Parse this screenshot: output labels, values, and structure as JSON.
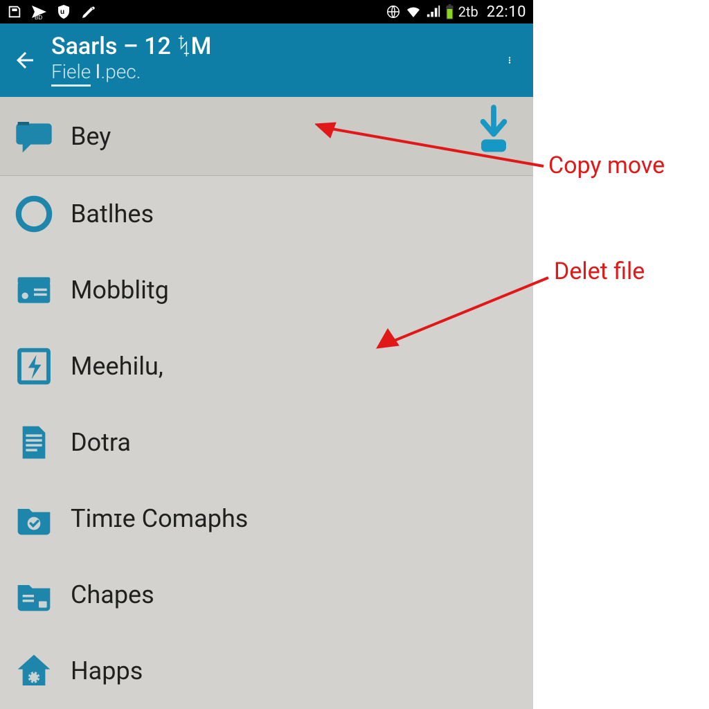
{
  "colors": {
    "accent": "#1797c4",
    "appbar": "#0f7ea6",
    "ann": "#e11818"
  },
  "status": {
    "date": "2tb",
    "time": "22:10"
  },
  "appbar": {
    "title": "Saarls – 12 ᛪM",
    "subtitle_prefix": "Fiele",
    "subtitle_rest": "ꓲ.pec."
  },
  "list": {
    "items": [
      {
        "label": "Bey"
      },
      {
        "label": "Batlhes"
      },
      {
        "label": "Mobblitg"
      },
      {
        "label": "Meehilu,"
      },
      {
        "label": "Dotra"
      },
      {
        "label": "Timɪe Comaphs"
      },
      {
        "label": "Chapes"
      },
      {
        "label": "Happs"
      }
    ]
  },
  "annotations": {
    "copymove": "Copy move",
    "deletefile": "Delet file"
  }
}
